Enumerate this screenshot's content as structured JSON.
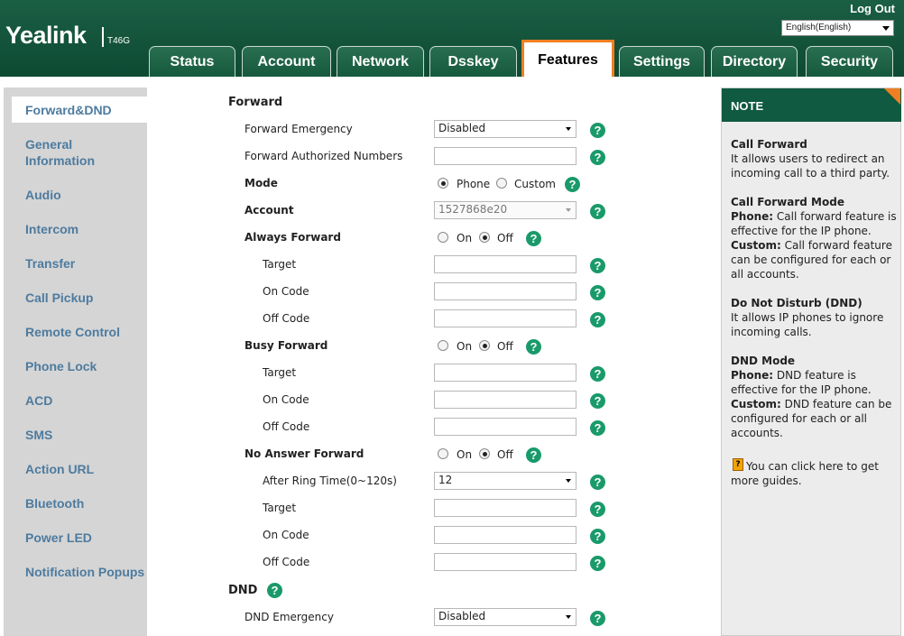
{
  "header": {
    "brand": "Yealink",
    "model": "T46G",
    "logout": "Log Out",
    "language": "English(English)"
  },
  "tabs": [
    "Status",
    "Account",
    "Network",
    "Dsskey",
    "Features",
    "Settings",
    "Directory",
    "Security"
  ],
  "active_tab": "Features",
  "sidebar": {
    "items": [
      "Forward&DND",
      "General Information",
      "Audio",
      "Intercom",
      "Transfer",
      "Call Pickup",
      "Remote Control",
      "Phone Lock",
      "ACD",
      "SMS",
      "Action URL",
      "Bluetooth",
      "Power LED",
      "Notification Popups"
    ],
    "active": "Forward&DND"
  },
  "form": {
    "forward_title": "Forward",
    "forward_emergency": {
      "label": "Forward Emergency",
      "value": "Disabled"
    },
    "forward_authorized": {
      "label": "Forward Authorized Numbers",
      "value": ""
    },
    "mode": {
      "label": "Mode",
      "phone": "Phone",
      "custom": "Custom",
      "selected": "Phone"
    },
    "account": {
      "label": "Account",
      "value": "1527868e20"
    },
    "always_forward": {
      "label": "Always Forward",
      "on": "On",
      "off": "Off",
      "selected": "Off"
    },
    "always_target": {
      "label": "Target",
      "value": ""
    },
    "always_on_code": {
      "label": "On Code",
      "value": ""
    },
    "always_off_code": {
      "label": "Off Code",
      "value": ""
    },
    "busy_forward": {
      "label": "Busy Forward",
      "on": "On",
      "off": "Off",
      "selected": "Off"
    },
    "busy_target": {
      "label": "Target",
      "value": ""
    },
    "busy_on_code": {
      "label": "On Code",
      "value": ""
    },
    "busy_off_code": {
      "label": "Off Code",
      "value": ""
    },
    "no_answer_forward": {
      "label": "No Answer Forward",
      "on": "On",
      "off": "Off",
      "selected": "Off"
    },
    "after_ring_time": {
      "label": "After Ring Time(0~120s)",
      "value": "12"
    },
    "noans_target": {
      "label": "Target",
      "value": ""
    },
    "noans_on_code": {
      "label": "On Code",
      "value": ""
    },
    "noans_off_code": {
      "label": "Off Code",
      "value": ""
    },
    "dnd_title": "DND",
    "dnd_emergency": {
      "label": "DND Emergency",
      "value": "Disabled"
    }
  },
  "note": {
    "title": "NOTE",
    "call_forward_title": "Call Forward",
    "call_forward_text": "It allows users to redirect an incoming call to a third party.",
    "cf_mode_title": "Call Forward Mode",
    "cf_mode_phone_label": "Phone:",
    "cf_mode_phone_text": " Call forward feature is effective for the IP phone.",
    "cf_mode_custom_label": "Custom:",
    "cf_mode_custom_text": " Call forward feature can be configured for each or all accounts.",
    "dnd_title": "Do Not Disturb (DND)",
    "dnd_text": "It allows IP phones to ignore incoming calls.",
    "dnd_mode_title": "DND Mode",
    "dnd_mode_phone_label": "Phone:",
    "dnd_mode_phone_text": " DND feature is effective for the IP phone.",
    "dnd_mode_custom_label": "Custom:",
    "dnd_mode_custom_text": " DND feature can be configured for each or all accounts.",
    "guide_text": " You can click here to get more guides."
  },
  "colors": {
    "brand_green": "#0f5a40",
    "accent_orange": "#f07f22",
    "help_green": "#1a9a6b",
    "sidebar_link": "#4d7b9f"
  }
}
